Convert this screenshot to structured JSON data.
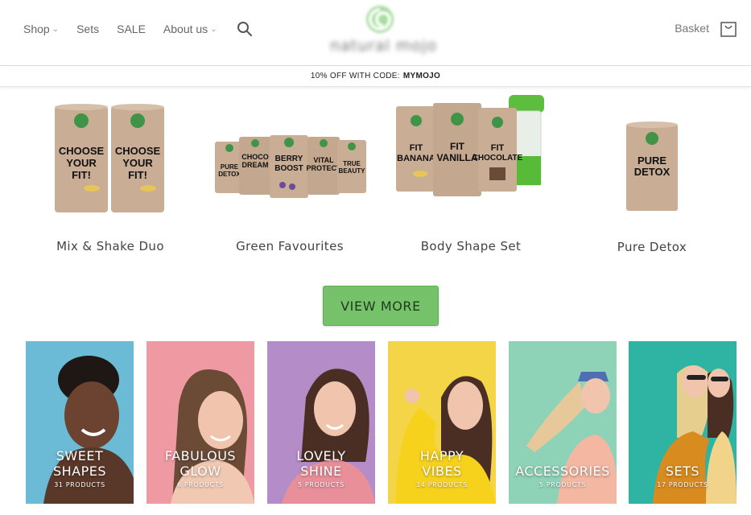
{
  "header": {
    "nav": [
      {
        "label": "Shop",
        "has_dropdown": true
      },
      {
        "label": "Sets",
        "has_dropdown": false
      },
      {
        "label": "SALE",
        "has_dropdown": false
      },
      {
        "label": "About us",
        "has_dropdown": true
      }
    ],
    "logo_text": "natural mojo",
    "basket_label": "Basket"
  },
  "promo": {
    "text": "10% OFF WITH CODE:",
    "code": "MYMOJO"
  },
  "products": [
    {
      "name": "Mix & Shake Duo",
      "can_labels": [
        "CHOOSE YOUR FIT!",
        "CHOOSE YOUR FIT!"
      ]
    },
    {
      "name": "Green Favourites",
      "can_labels": [
        "PURE DETOX",
        "CHOCO DREAM",
        "BERRY BOOST",
        "VITAL PROTECT",
        "TRUE BEAUTY"
      ]
    },
    {
      "name": "Body Shape Set",
      "can_labels": [
        "FIT BANANA",
        "FIT VANILLA",
        "FIT CHOCOLATE"
      ]
    },
    {
      "name": "Pure Detox",
      "can_labels": [
        "PURE DETOX"
      ]
    }
  ],
  "view_more_label": "VIEW MORE",
  "categories": [
    {
      "title": "SWEET\nSHAPES",
      "count": "31 PRODUCTS",
      "bg": "#6bbad6"
    },
    {
      "title": "FABULOUS\nGLOW",
      "count": "6 PRODUCTS",
      "bg": "#ef9aa3"
    },
    {
      "title": "LOVELY\nSHINE",
      "count": "5 PRODUCTS",
      "bg": "#b48cc7"
    },
    {
      "title": "HAPPY\nVIBES",
      "count": "14 PRODUCTS",
      "bg": "#f3d547"
    },
    {
      "title": "ACCESSORIES",
      "count": "5 PRODUCTS",
      "bg": "#8ed2b7"
    },
    {
      "title": "SETS",
      "count": "17 PRODUCTS",
      "bg": "#2fb3a3"
    }
  ],
  "colors": {
    "brand_green": "#76c26a",
    "can_kraft": "#c9ad95",
    "can_badge": "#3f9447"
  },
  "icons": {
    "search": "search-icon",
    "basket": "basket-icon",
    "dropdown": "chevron-down-icon"
  }
}
